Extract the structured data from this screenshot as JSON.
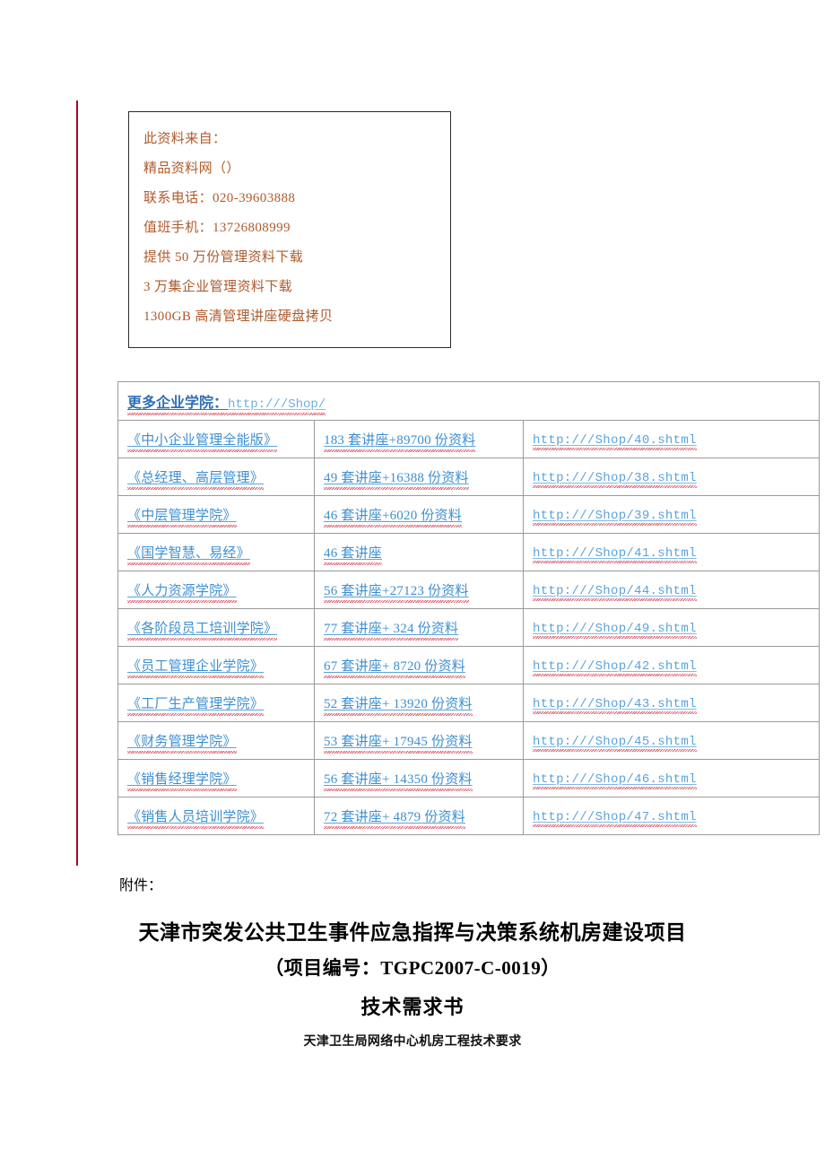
{
  "info_box": {
    "lines": [
      "此资料来自：",
      "精品资料网（）",
      "联系电话：020-39603888",
      "值班手机：13726808999",
      "提供 50 万份管理资料下载",
      "3 万集企业管理资料下载",
      "1300GB 高清管理讲座硬盘拷贝"
    ],
    "text_color": "#b05a2b"
  },
  "link_table": {
    "header": {
      "label": "更多企业学院：",
      "url": "http:///Shop/"
    },
    "rows": [
      {
        "name": "《中小企业管理全能版》",
        "count": "183 套讲座+89700 份资料",
        "url": "http:///Shop/40.shtml"
      },
      {
        "name": "《总经理、高层管理》",
        "count": "49 套讲座+16388 份资料",
        "url": "http:///Shop/38.shtml"
      },
      {
        "name": "《中层管理学院》",
        "count": "46 套讲座+6020 份资料",
        "url": "http:///Shop/39.shtml"
      },
      {
        "name": "《国学智慧、易经》",
        "count": "46 套讲座",
        "url": "http:///Shop/41.shtml"
      },
      {
        "name": "《人力资源学院》",
        "count": "56 套讲座+27123 份资料",
        "url": "http:///Shop/44.shtml"
      },
      {
        "name": "《各阶段员工培训学院》",
        "count": "77 套讲座+ 324 份资料",
        "url": "http:///Shop/49.shtml"
      },
      {
        "name": "《员工管理企业学院》",
        "count": "67 套讲座+ 8720 份资料",
        "url": "http:///Shop/42.shtml"
      },
      {
        "name": "《工厂生产管理学院》",
        "count": "52 套讲座+ 13920 份资料",
        "url": "http:///Shop/43.shtml"
      },
      {
        "name": "《财务管理学院》",
        "count": "53 套讲座+ 17945 份资料",
        "url": "http:///Shop/45.shtml"
      },
      {
        "name": "《销售经理学院》",
        "count": "56 套讲座+ 14350 份资料",
        "url": "http:///Shop/46.shtml"
      },
      {
        "name": "《销售人员培训学院》",
        "count": "72 套讲座+ 4879 份资料",
        "url": "http:///Shop/47.shtml"
      }
    ],
    "link_color": "#3d8fd1",
    "spellcheck_underline_color": "#d93b4e"
  },
  "document": {
    "attachment_label": "附件：",
    "title": "天津市突发公共卫生事件应急指挥与决策系统机房建设项目",
    "project_code": "（项目编号：TGPC2007-C-0019）",
    "subtitle": "技术需求书",
    "caption": "天津卫生局网络中心机房工程技术要求"
  }
}
